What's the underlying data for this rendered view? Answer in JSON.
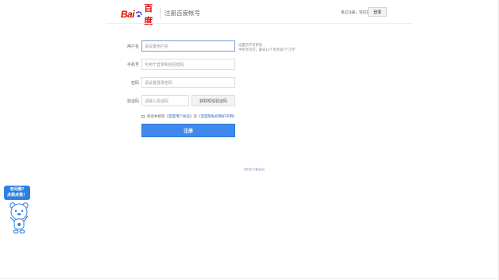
{
  "header": {
    "logo_bai": "Bai",
    "logo_du": "百度",
    "title": "注册百度帐号",
    "have_account": "我已注册，现在就",
    "login_label": "登录"
  },
  "form": {
    "username": {
      "label": "用户名",
      "placeholder": "请设置用户名"
    },
    "phone": {
      "label": "手机号",
      "placeholder": "可用于登录和找回密码"
    },
    "password": {
      "label": "密码",
      "placeholder": "请设置登录密码"
    },
    "code": {
      "label": "验证码",
      "placeholder": "请输入验证码",
      "button": "获取短信验证码"
    },
    "hint_line1": "设置后不可更改",
    "hint_line2": "中英文均可，最长14个英文或7个汉字",
    "agree_prefix": "阅读并接受",
    "agree_link1": "《百度用户协议》",
    "agree_and": "及",
    "agree_link2": "《百度隐私权保护声明》",
    "submit": "注册"
  },
  "footer": {
    "copyright": "2019 ©Baidu"
  },
  "help": {
    "line1": "有问题?",
    "line2": "点我点我！"
  },
  "colors": {
    "brand_red": "#e10601",
    "primary_blue": "#3f89ec",
    "link_blue": "#2d64b3"
  }
}
